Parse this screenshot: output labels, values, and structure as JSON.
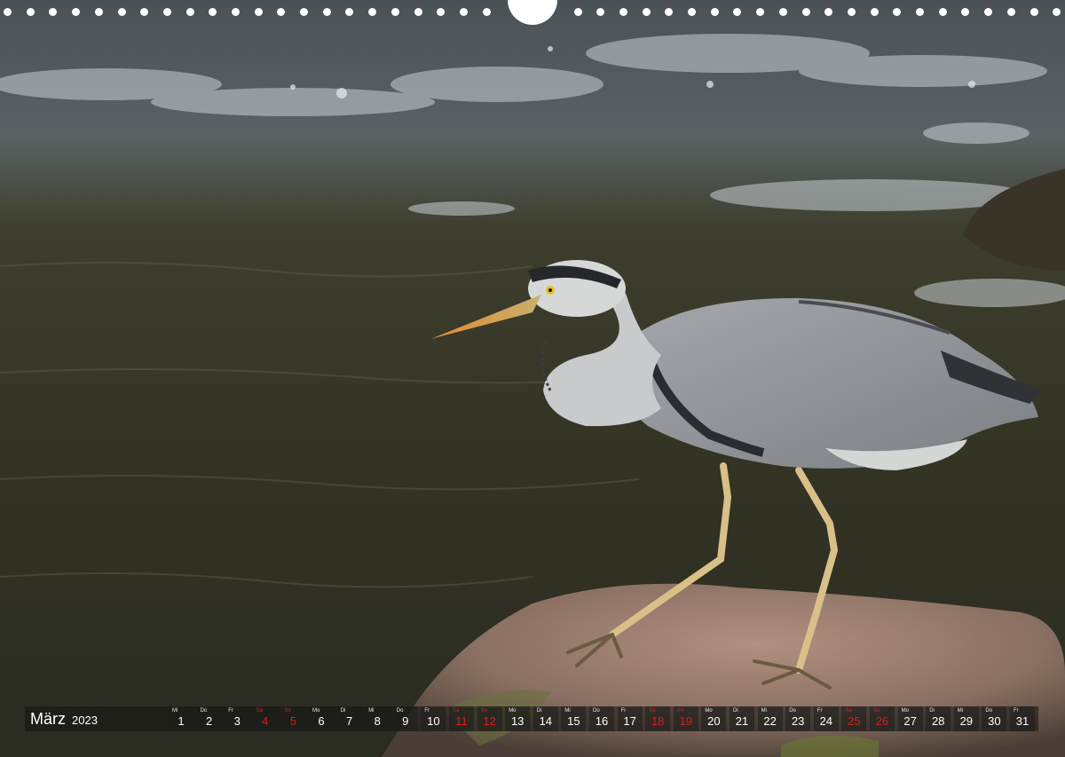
{
  "photo": {
    "subject": "heron-on-rock"
  },
  "calendar": {
    "month": "März",
    "year": "2023",
    "days": [
      {
        "dow": "Mi",
        "num": "1",
        "weekend": false
      },
      {
        "dow": "Do",
        "num": "2",
        "weekend": false
      },
      {
        "dow": "Fr",
        "num": "3",
        "weekend": false
      },
      {
        "dow": "Sa",
        "num": "4",
        "weekend": true
      },
      {
        "dow": "So",
        "num": "5",
        "weekend": true
      },
      {
        "dow": "Mo",
        "num": "6",
        "weekend": false
      },
      {
        "dow": "Di",
        "num": "7",
        "weekend": false
      },
      {
        "dow": "Mi",
        "num": "8",
        "weekend": false
      },
      {
        "dow": "Do",
        "num": "9",
        "weekend": false
      },
      {
        "dow": "Fr",
        "num": "10",
        "weekend": false
      },
      {
        "dow": "Sa",
        "num": "11",
        "weekend": true
      },
      {
        "dow": "So",
        "num": "12",
        "weekend": true
      },
      {
        "dow": "Mo",
        "num": "13",
        "weekend": false
      },
      {
        "dow": "Di",
        "num": "14",
        "weekend": false
      },
      {
        "dow": "Mi",
        "num": "15",
        "weekend": false
      },
      {
        "dow": "Do",
        "num": "16",
        "weekend": false
      },
      {
        "dow": "Fr",
        "num": "17",
        "weekend": false
      },
      {
        "dow": "Sa",
        "num": "18",
        "weekend": true
      },
      {
        "dow": "So",
        "num": "19",
        "weekend": true
      },
      {
        "dow": "Mo",
        "num": "20",
        "weekend": false
      },
      {
        "dow": "Di",
        "num": "21",
        "weekend": false
      },
      {
        "dow": "Mi",
        "num": "22",
        "weekend": false
      },
      {
        "dow": "Do",
        "num": "23",
        "weekend": false
      },
      {
        "dow": "Fr",
        "num": "24",
        "weekend": false
      },
      {
        "dow": "Sa",
        "num": "25",
        "weekend": true
      },
      {
        "dow": "So",
        "num": "26",
        "weekend": true
      },
      {
        "dow": "Mo",
        "num": "27",
        "weekend": false
      },
      {
        "dow": "Di",
        "num": "28",
        "weekend": false
      },
      {
        "dow": "Mi",
        "num": "29",
        "weekend": false
      },
      {
        "dow": "Do",
        "num": "30",
        "weekend": false
      },
      {
        "dow": "Fr",
        "num": "31",
        "weekend": false
      }
    ]
  },
  "colors": {
    "weekend": "#d81e1e",
    "water": "#3a3a2c",
    "heron_body": "#8e9296",
    "beak": "#e08a30"
  }
}
